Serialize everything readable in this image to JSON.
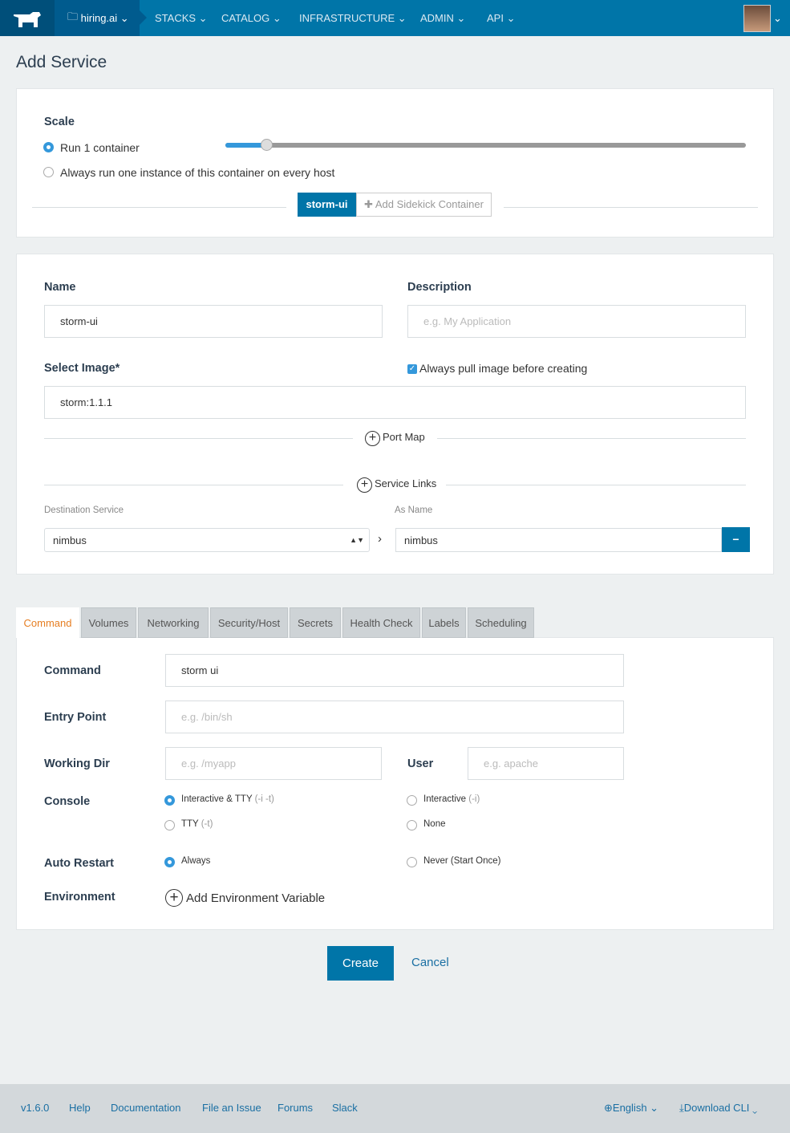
{
  "nav": {
    "env": "hiring.ai",
    "items": [
      "STACKS",
      "CATALOG",
      "INFRASTRUCTURE",
      "ADMIN",
      "API"
    ]
  },
  "page_title": "Add Service",
  "scale": {
    "label": "Scale",
    "run_option": "Run 1 container",
    "global_option": "Always run one instance of this container on every host",
    "slider_value": 1,
    "selected": "run"
  },
  "containers": {
    "active": "storm-ui",
    "add_sidekick": "Add Sidekick Container"
  },
  "form": {
    "name_label": "Name",
    "name_value": "storm-ui",
    "desc_label": "Description",
    "desc_placeholder": "e.g. My Application",
    "image_label": "Select Image*",
    "pull_label": "Always pull image before creating",
    "pull_checked": true,
    "image_value": "storm:1.1.1",
    "port_map": "Port Map",
    "service_links": "Service Links",
    "dest_label": "Destination Service",
    "as_label": "As Name",
    "dest_value": "nimbus",
    "as_value": "nimbus"
  },
  "tabs": [
    "Command",
    "Volumes",
    "Networking",
    "Security/Host",
    "Secrets",
    "Health Check",
    "Labels",
    "Scheduling"
  ],
  "active_tab": "Command",
  "command": {
    "command_label": "Command",
    "command_value": "storm ui",
    "entry_label": "Entry Point",
    "entry_ph": "e.g. /bin/sh",
    "wd_label": "Working Dir",
    "wd_ph": "e.g. /myapp",
    "user_label": "User",
    "user_ph": "e.g. apache",
    "console_label": "Console",
    "console_opts": [
      {
        "t": "Interactive & TTY",
        "h": "(-i -t)"
      },
      {
        "t": "Interactive",
        "h": "(-i)"
      },
      {
        "t": "TTY",
        "h": "(-t)"
      },
      {
        "t": "None",
        "h": ""
      }
    ],
    "restart_label": "Auto Restart",
    "restart_opts": [
      "Always",
      "Never (Start Once)"
    ],
    "env_label": "Environment",
    "add_env": "Add Environment Variable"
  },
  "actions": {
    "create": "Create",
    "cancel": "Cancel"
  },
  "footer": {
    "version": "v1.6.0",
    "links": [
      "Help",
      "Documentation",
      "File an Issue",
      "Forums",
      "Slack"
    ],
    "language": "English",
    "download": "Download CLI"
  },
  "colors": {
    "nav": "#0075a8",
    "primary": "#0075a8",
    "active_tab": "#e67e22"
  }
}
